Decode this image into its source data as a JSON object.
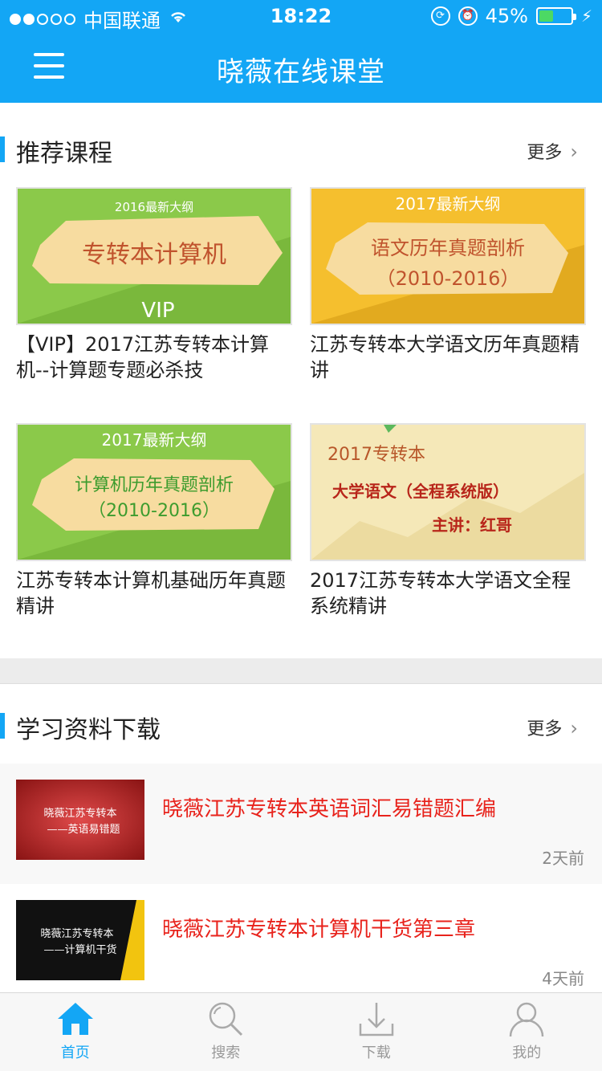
{
  "status_bar": {
    "carrier": "中国联通",
    "time": "18:22",
    "battery": "45%",
    "battery_level": 0.45
  },
  "nav": {
    "title": "晓薇在线课堂",
    "menu_icon": "hamburger-menu-icon"
  },
  "recommended": {
    "title": "推荐课程",
    "more": "更多",
    "courses": [
      {
        "name": "【VIP】2017江苏专转本计算机--计算题专题必杀技",
        "thumb_top": "2016最新大纲",
        "thumb_main": "专转本计算机",
        "thumb_sub": "VIP",
        "thumb_color": "#8bc94a"
      },
      {
        "name": "江苏专转本大学语文历年真题精讲",
        "thumb_top": "2017最新大纲",
        "thumb_main": "语文历年真题剖析",
        "thumb_sub": "（2010-2016）",
        "thumb_color": "#f5bf2e"
      },
      {
        "name": "江苏专转本计算机基础历年真题精讲",
        "thumb_top": "2017最新大纲",
        "thumb_main": "计算机历年真题剖析",
        "thumb_sub": "（2010-2016）",
        "thumb_color": "#8bc94a"
      },
      {
        "name": "2017江苏专转本大学语文全程系统精讲",
        "thumb_top": "2017专转本",
        "thumb_main": "大学语文（全程系统版）",
        "thumb_sub": "主讲：红哥",
        "thumb_color": "#f5e8b8"
      }
    ]
  },
  "downloads": {
    "title": "学习资料下载",
    "more": "更多",
    "items": [
      {
        "title": "晓薇江苏专转本英语词汇易错题汇编",
        "time": "2天前",
        "thumb_line1": "晓薇江苏专转本",
        "thumb_line2": "——英语易错题"
      },
      {
        "title": "晓薇江苏专转本计算机干货第三章",
        "time": "4天前",
        "thumb_line1": "晓薇江苏专转本",
        "thumb_line2": "——计算机干货"
      }
    ]
  },
  "tabbar": {
    "tabs": [
      {
        "label": "首页",
        "icon": "home-icon",
        "active": true
      },
      {
        "label": "搜索",
        "icon": "search-icon",
        "active": false
      },
      {
        "label": "下载",
        "icon": "download-icon",
        "active": false
      },
      {
        "label": "我的",
        "icon": "user-icon",
        "active": false
      }
    ]
  },
  "colors": {
    "accent": "#13a6f5",
    "download_title": "#e8231c"
  }
}
